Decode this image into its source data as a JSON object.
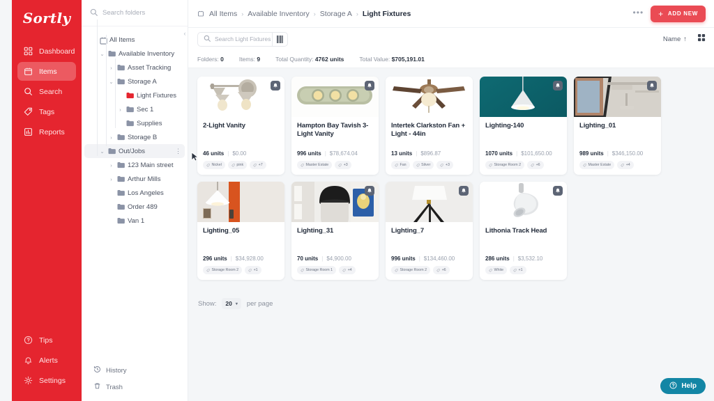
{
  "brand": {
    "name": "Sortly"
  },
  "sidebar": {
    "items": [
      {
        "label": "Dashboard",
        "icon": "dashboard-icon",
        "active": false
      },
      {
        "label": "Items",
        "icon": "box-icon",
        "active": true
      },
      {
        "label": "Search",
        "icon": "search-icon",
        "active": false
      },
      {
        "label": "Tags",
        "icon": "tag-icon",
        "active": false
      },
      {
        "label": "Reports",
        "icon": "reports-icon",
        "active": false
      }
    ],
    "bottom_items": [
      {
        "label": "Tips",
        "icon": "question-icon"
      },
      {
        "label": "Alerts",
        "icon": "bell-icon"
      },
      {
        "label": "Settings",
        "icon": "gear-icon"
      }
    ]
  },
  "folder_panel": {
    "search_placeholder": "Search folders",
    "collapse_icon": "chevron-left-icon",
    "tree": [
      {
        "label": "All Items",
        "depth": 0,
        "chevron": "none",
        "icon": "all-items-icon",
        "selected": false
      },
      {
        "label": "Available Inventory",
        "depth": 1,
        "chevron": "down",
        "icon": "folder-icon",
        "selected": false
      },
      {
        "label": "Asset Tracking",
        "depth": 2,
        "chevron": "right",
        "icon": "folder-icon",
        "selected": false
      },
      {
        "label": "Storage A",
        "depth": 2,
        "chevron": "down",
        "icon": "folder-icon",
        "selected": false
      },
      {
        "label": "Light Fixtures",
        "depth": 3,
        "chevron": "none",
        "icon": "folder-icon-red",
        "selected": false
      },
      {
        "label": "Sec 1",
        "depth": 3,
        "chevron": "right",
        "icon": "folder-icon",
        "selected": false
      },
      {
        "label": "Supplies",
        "depth": 3,
        "chevron": "none",
        "icon": "folder-icon",
        "selected": false
      },
      {
        "label": "Storage B",
        "depth": 2,
        "chevron": "right",
        "icon": "folder-icon",
        "selected": false
      },
      {
        "label": "Out/Jobs",
        "depth": 1,
        "chevron": "down",
        "icon": "folder-icon",
        "selected": true,
        "kebab": "⋮"
      },
      {
        "label": "123 Main street",
        "depth": 2,
        "chevron": "right",
        "icon": "folder-icon",
        "selected": false
      },
      {
        "label": "Arthur Mills",
        "depth": 2,
        "chevron": "right",
        "icon": "folder-icon",
        "selected": false
      },
      {
        "label": "Los Angeles",
        "depth": 2,
        "chevron": "none",
        "icon": "folder-icon",
        "selected": false
      },
      {
        "label": "Order 489",
        "depth": 2,
        "chevron": "none",
        "icon": "folder-icon",
        "selected": false
      },
      {
        "label": "Van 1",
        "depth": 2,
        "chevron": "none",
        "icon": "folder-icon",
        "selected": false
      }
    ],
    "bottom": [
      {
        "label": "History",
        "icon": "history-icon"
      },
      {
        "label": "Trash",
        "icon": "trash-icon"
      }
    ]
  },
  "header": {
    "breadcrumb": [
      "All Items",
      "Available Inventory",
      "Storage A",
      "Light Fixtures"
    ],
    "separator": "›",
    "more_label": "•••",
    "add_new_label": "ADD NEW",
    "add_new_plus": "+",
    "add_new_color": "#ea4b54"
  },
  "toolbar": {
    "search_placeholder": "Search Light Fixtures",
    "barcode_icon": "barcode-icon",
    "sort_label": "Name",
    "sort_arrow": "↑",
    "grid_view_icon": "grid-view-icon"
  },
  "stats": [
    {
      "label": "Folders:",
      "value": "0"
    },
    {
      "label": "Items:",
      "value": "9"
    },
    {
      "label": "Total Quantity:",
      "value": "4762 units"
    },
    {
      "label": "Total Value:",
      "value": "$705,191.01"
    }
  ],
  "items": [
    {
      "name": "2-Light Vanity",
      "units": "46 units",
      "value": "$0.00",
      "tags": [
        "Nickel",
        "pink",
        "+7"
      ],
      "thumb": "vanity-2light",
      "bell": true
    },
    {
      "name": "Hampton Bay Tavish 3-Light Vanity",
      "units": "996 units",
      "value": "$78,674.04",
      "tags": [
        "Master Estate",
        "+3"
      ],
      "thumb": "vanity-3light",
      "bell": true
    },
    {
      "name": "Intertek Clarkston Fan + Light - 44in",
      "units": "13 units",
      "value": "$896.87",
      "tags": [
        "Fan",
        "Silver",
        "+3"
      ],
      "thumb": "ceiling-fan",
      "bell": false
    },
    {
      "name": "Lighting-140",
      "units": "1070 units",
      "value": "$101,650.00",
      "tags": [
        "Storage Room 2",
        "+6"
      ],
      "thumb": "pendant-teal",
      "bell": true
    },
    {
      "name": "Lighting_01",
      "units": "989 units",
      "value": "$346,150.00",
      "tags": [
        "Master Estate",
        "+4"
      ],
      "thumb": "ceiling-industrial",
      "bell": true
    },
    {
      "name": "Lighting_05",
      "units": "296 units",
      "value": "$34,928.00",
      "tags": [
        "Storage Room 2",
        "+1"
      ],
      "thumb": "pendant-room",
      "bell": false
    },
    {
      "name": "Lighting_31",
      "units": "70 units",
      "value": "$4,900.00",
      "tags": [
        "Storage Room 1",
        "+4"
      ],
      "thumb": "black-pendant",
      "bell": true
    },
    {
      "name": "Lighting_7",
      "units": "996 units",
      "value": "$134,460.00",
      "tags": [
        "Storage Room 2",
        "+6"
      ],
      "thumb": "tripod-lamp",
      "bell": true
    },
    {
      "name": "Lithonia Track Head",
      "units": "286 units",
      "value": "$3,532.10",
      "tags": [
        "White",
        "+1"
      ],
      "thumb": "track-head",
      "bell": true
    }
  ],
  "pagination": {
    "show_label": "Show:",
    "per_page_value": "20",
    "per_page_label": "per page",
    "caret": "▾"
  },
  "help": {
    "label": "Help",
    "icon": "question-circle-icon",
    "color": "#1386a5"
  }
}
